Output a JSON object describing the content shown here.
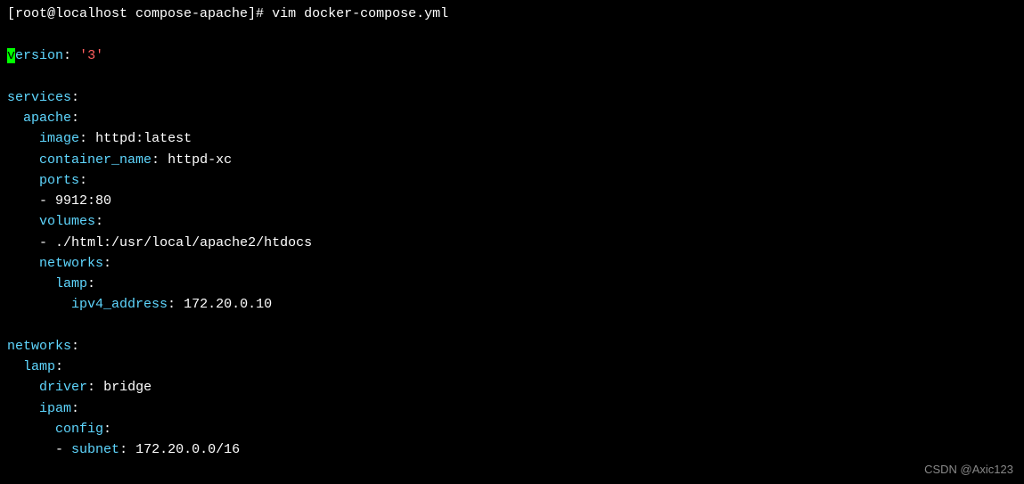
{
  "prompt": {
    "user_host": "[root@localhost compose-apache]#",
    "command": "vim docker-compose.yml"
  },
  "yaml": {
    "version_key": "ersion",
    "version_cursor": "v",
    "colon": ":",
    "version_val": "'3'",
    "services_key": "services",
    "apache_key": "apache",
    "image_key": "image",
    "image_val": "httpd:latest",
    "container_name_key": "container_name",
    "container_name_val": "httpd-xc",
    "ports_key": "ports",
    "ports_val": "9912:80",
    "volumes_key": "volumes",
    "volumes_val": "./html:/usr/local/apache2/htdocs",
    "networks_svc_key": "networks",
    "lamp_svc_key": "lamp",
    "ipv4_key": "ipv4_address",
    "ipv4_val": "172.20.0.10",
    "networks_key": "networks",
    "lamp_key": "lamp",
    "driver_key": "driver",
    "driver_val": "bridge",
    "ipam_key": "ipam",
    "config_key": "config",
    "subnet_key": "subnet",
    "subnet_val": "172.20.0.0/16",
    "dash": "-"
  },
  "watermark": "CSDN @Axic123"
}
